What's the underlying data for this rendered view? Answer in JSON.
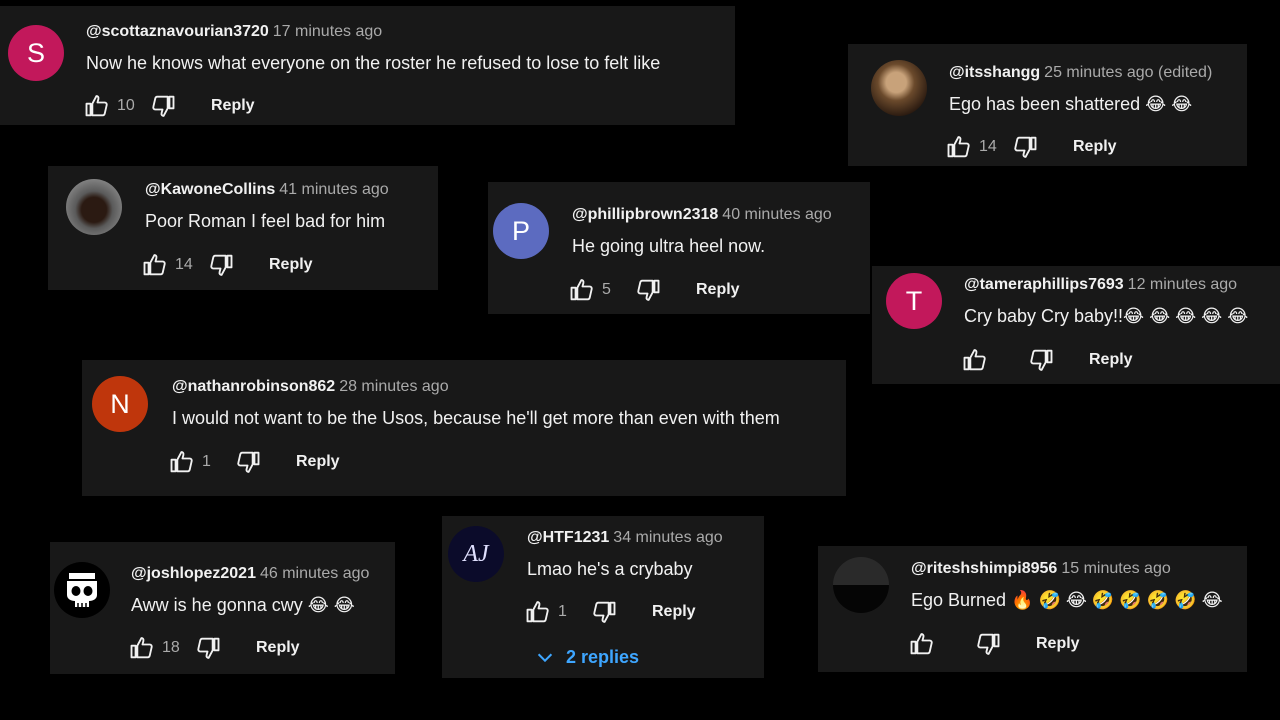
{
  "comments": [
    {
      "handle": "@scottaznavourian3720",
      "time": "17 minutes ago",
      "text": "Now he knows what everyone on  the roster he refused to lose to felt like",
      "likes": "10",
      "reply": "Reply",
      "avatar_letter": "S",
      "avatar_color": "#c2185b"
    },
    {
      "handle": "@itsshangg",
      "time": "25 minutes ago (edited)",
      "text": "Ego has been shattered 😂 😂",
      "likes": "14",
      "reply": "Reply",
      "avatar_letter": "",
      "avatar_color": "#5a4632"
    },
    {
      "handle": "@KawoneCollins",
      "time": "41 minutes ago",
      "text": "Poor Roman I feel bad for him",
      "likes": "14",
      "reply": "Reply",
      "avatar_letter": "",
      "avatar_color": "#6b6b6b"
    },
    {
      "handle": "@phillipbrown2318",
      "time": "40 minutes ago",
      "text": "He going ultra heel now.",
      "likes": "5",
      "reply": "Reply",
      "avatar_letter": "P",
      "avatar_color": "#5c6bc0"
    },
    {
      "handle": "@tameraphillips7693",
      "time": "12 minutes ago",
      "text": "Cry baby Cry baby!!😂 😂 😂 😂 😂",
      "likes": "",
      "reply": "Reply",
      "avatar_letter": "T",
      "avatar_color": "#c2185b"
    },
    {
      "handle": "@nathanrobinson862",
      "time": "28 minutes ago",
      "text": "I would not want to be the Usos, because he'll get more than even with them",
      "likes": "1",
      "reply": "Reply",
      "avatar_letter": "N",
      "avatar_color": "#bf360c"
    },
    {
      "handle": "@joshlopez2021",
      "time": "46 minutes ago",
      "text": "Aww is he gonna cwy 😂 😂",
      "likes": "18",
      "reply": "Reply",
      "avatar_letter": "",
      "avatar_color": "#000000"
    },
    {
      "handle": "@HTF1231",
      "time": "34 minutes ago",
      "text": "Lmao he's a crybaby",
      "likes": "1",
      "reply": "Reply",
      "replies_label": "2 replies",
      "avatar_letter": "AJ",
      "avatar_color": "#0b0b2a"
    },
    {
      "handle": "@riteshshimpi8956",
      "time": "15 minutes ago",
      "text": "Ego Burned 🔥 🤣 😂 🤣 🤣 🤣 🤣 😂",
      "likes": "",
      "reply": "Reply",
      "avatar_letter": "",
      "avatar_color": "#0a0a0a"
    }
  ]
}
